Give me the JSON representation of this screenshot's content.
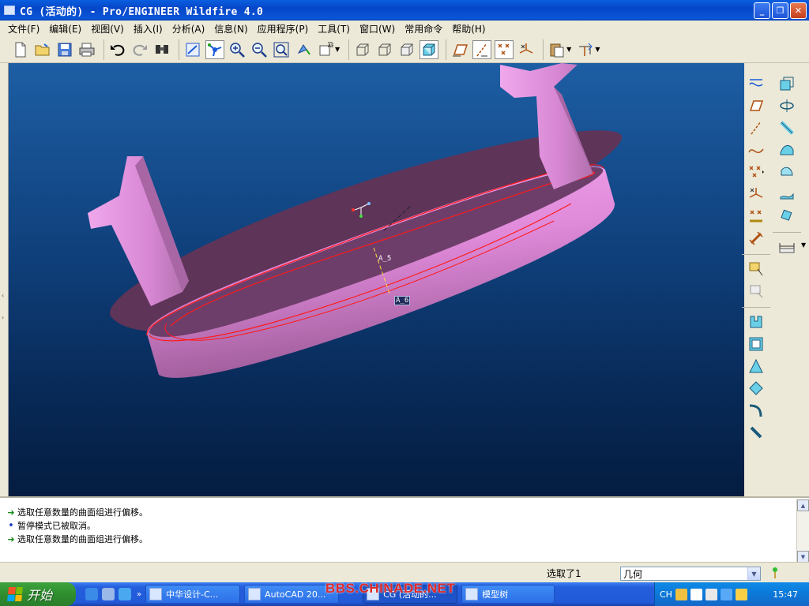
{
  "window": {
    "title": "CG (活动的) - Pro/ENGINEER Wildfire 4.0",
    "buttons": {
      "minimize": "_",
      "restore": "❐",
      "close": "✕"
    }
  },
  "menu": [
    "文件(F)",
    "编辑(E)",
    "视图(V)",
    "插入(I)",
    "分析(A)",
    "信息(N)",
    "应用程序(P)",
    "工具(T)",
    "窗口(W)",
    "常用命令",
    "帮助(H)"
  ],
  "toolbar": {
    "icons": [
      "new-icon",
      "open-icon",
      "save-icon",
      "print-icon",
      "undo-icon",
      "redo-icon",
      "find-icon",
      "repaint-icon",
      "spin-center-icon",
      "zoom-in-icon",
      "zoom-out-icon",
      "refit-icon",
      "reorient-icon",
      "saved-views-icon",
      "hidden-line-icon",
      "no-hidden-icon",
      "wireframe-icon",
      "shading-icon",
      "datum-planes-icon",
      "datum-axes-icon",
      "datum-points-icon",
      "csys-icon",
      "paste-icon",
      "paste-special-icon"
    ]
  },
  "viewport": {
    "labels": {
      "axis_a5": "A_5",
      "axis_a6": "A_6"
    },
    "colors": {
      "part": "#e48ee0",
      "part_dark": "#6a3a66",
      "edge_highlight": "#ff1a1a"
    }
  },
  "messages": [
    {
      "type": "prompt",
      "text": "选取任意数量的曲面组进行偏移。"
    },
    {
      "type": "info",
      "text": "暂停模式已被取消。"
    },
    {
      "type": "prompt",
      "text": "选取任意数量的曲面组进行偏移。"
    }
  ],
  "status": {
    "selection": "选取了1",
    "filter": "几何"
  },
  "taskbar": {
    "start": "开始",
    "tasks": [
      {
        "label": "中华设计-C...",
        "active": false
      },
      {
        "label": "AutoCAD 20...",
        "active": false
      },
      {
        "label": "CG (活动的...",
        "active": true
      },
      {
        "label": "模型树",
        "active": false
      }
    ],
    "tray": {
      "lang": "CH",
      "clock": "15:47"
    },
    "watermark": "BBS.CHINADE.NET"
  }
}
